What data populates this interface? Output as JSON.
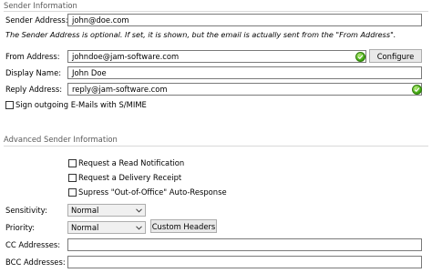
{
  "sender_section": {
    "title": "Sender Information",
    "sender_address": {
      "label": "Sender Address:",
      "value": "john@doe.com"
    },
    "note": "The Sender Address is optional. If set, it is shown, but the email is actually sent from the \"From Address\".",
    "from_address": {
      "label": "From Address:",
      "value": "johndoe@jam-software.com"
    },
    "configure_button": "Configure",
    "display_name": {
      "label": "Display Name:",
      "value": "John Doe"
    },
    "reply_address": {
      "label": "Reply Address:",
      "value": "reply@jam-software.com"
    },
    "smime_checkbox": {
      "label": "Sign outgoing E-Mails with S/MIME",
      "checked": false
    }
  },
  "advanced_section": {
    "title": "Advanced Sender Information",
    "read_notification": {
      "label": "Request a Read Notification",
      "checked": false
    },
    "delivery_receipt": {
      "label": "Request a Delivery Receipt",
      "checked": false
    },
    "suppress_ooo": {
      "label": "Supress \"Out-of-Office\" Auto-Response",
      "checked": false
    },
    "sensitivity": {
      "label": "Sensitivity:",
      "value": "Normal"
    },
    "priority": {
      "label": "Priority:",
      "value": "Normal"
    },
    "custom_headers_button": "Custom Headers",
    "cc_addresses": {
      "label": "CC Addresses:",
      "value": ""
    },
    "bcc_addresses": {
      "label": "BCC Addresses:",
      "value": ""
    }
  },
  "colors": {
    "valid_indicator": "#39a10b"
  }
}
